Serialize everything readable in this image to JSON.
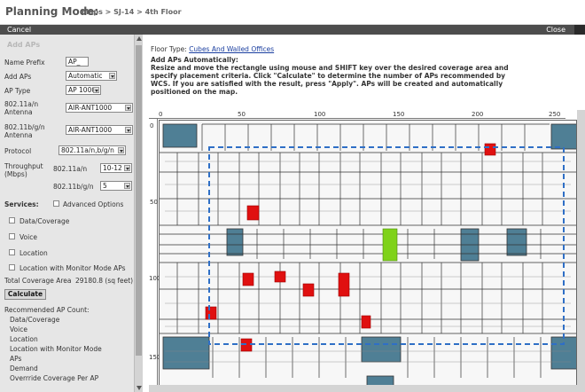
{
  "header": {
    "mode": "Planning Mode:",
    "breadcrumb": "Maps > SJ-14 > 4th Floor"
  },
  "toolbar": {
    "cancel": "Cancel",
    "close": "Close"
  },
  "sidebar": {
    "section_title": "Add APs",
    "name_prefix_label": "Name Prefix",
    "name_prefix_value": "AP_",
    "add_aps_label": "Add APs",
    "add_aps_value": "Automatic",
    "ap_type_label": "AP Type",
    "ap_type_value": "AP 1000",
    "antenna_an_label_1": "802.11a/n",
    "antenna_an_label_2": "Antenna",
    "antenna_an_value": "AIR-ANT1000",
    "antenna_bgn_label_1": "802.11b/g/n",
    "antenna_bgn_label_2": "Antenna",
    "antenna_bgn_value": "AIR-ANT1000",
    "protocol_label": "Protocol",
    "protocol_value": "802.11a/n,b/g/n",
    "throughput_label_1": "Throughput",
    "throughput_label_2": "(Mbps)",
    "throughput_an_label": "802.11a/n",
    "throughput_an_value": "10-12",
    "throughput_bgn_label": "802.11b/g/n",
    "throughput_bgn_value": "5",
    "services_label": "Services:",
    "advanced_options_label": "Advanced Options",
    "service_data": "Data/Coverage",
    "service_voice": "Voice",
    "service_location": "Location",
    "service_location_monitor": "Location with Monitor Mode APs",
    "total_coverage_label": "Total Coverage Area",
    "total_coverage_value": "29180.8 (sq feet)",
    "calculate_button": "Calculate",
    "recommended_title": "Recommended AP Count:",
    "recommended_items": [
      "Data/Coverage",
      "Voice",
      "Location",
      "Location with Monitor Mode",
      "APs",
      "Demand",
      "Overrride Coverage Per AP"
    ]
  },
  "main": {
    "floor_type_label": "Floor Type:",
    "floor_type_link": "Cubes And Walled Offices",
    "instructions_title": "Add APs Automatically:",
    "instructions_text": "Resize and move the rectangle using mouse and SHIFT key over the desired coverage area and specify placement criteria. Click \"Calculate\" to determine the number of APs recommended by WCS. If you are satisfied with the result, press \"Apply\". APs will be created and automatically positioned on the map."
  },
  "map": {
    "ruler_top_ticks": [
      "0",
      "50",
      "100",
      "150",
      "200",
      "250"
    ],
    "ruler_left_ticks": [
      "0",
      "50",
      "100",
      "150"
    ],
    "colors": {
      "highlight_red": "#e01010",
      "highlight_green": "#7fd21a",
      "dashed_blue": "#2f6fc6",
      "teal_room": "#4f7f95"
    }
  }
}
